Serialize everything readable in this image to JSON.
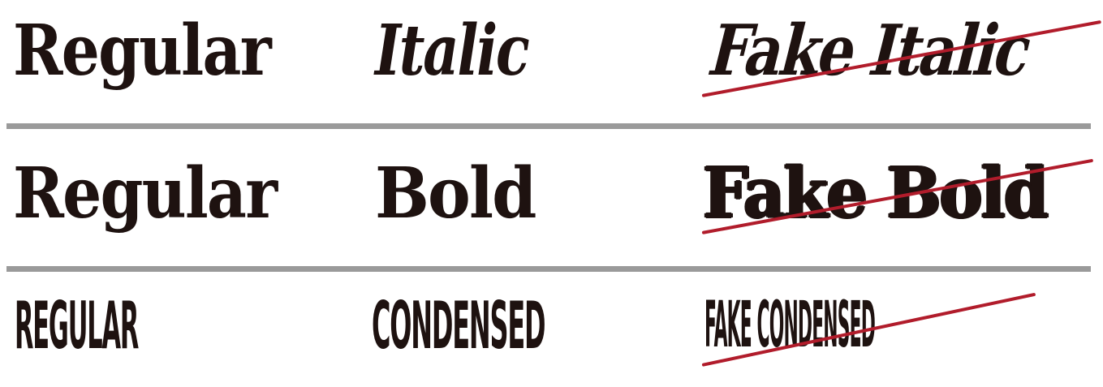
{
  "rows": {
    "italic": {
      "regular": "Regular",
      "true_style": "Italic",
      "fake_style": "Fake Italic"
    },
    "bold": {
      "regular": "Regular",
      "true_style": "Bold",
      "fake_style": "Fake Bold"
    },
    "condensed": {
      "regular": "REGULAR",
      "true_style": "CONDENSED",
      "fake_style": "FAKE CONDENSED"
    }
  },
  "colors": {
    "text": "#1e1210",
    "divider": "#9a9a9a",
    "strike": "#b11c2b",
    "background": "#ffffff"
  }
}
